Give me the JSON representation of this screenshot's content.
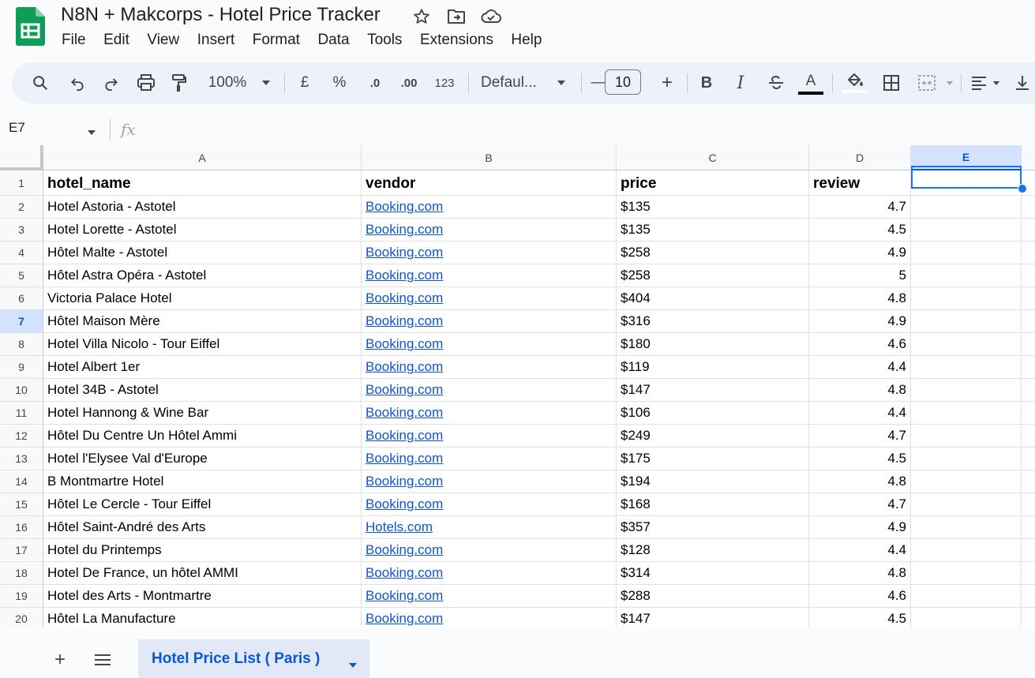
{
  "app": {
    "title": "N8N + Makcorps - Hotel Price Tracker",
    "menu": [
      "File",
      "Edit",
      "View",
      "Insert",
      "Format",
      "Data",
      "Tools",
      "Extensions",
      "Help"
    ],
    "title_icons": [
      "star-icon",
      "move-folder-icon",
      "cloud-status-icon"
    ]
  },
  "toolbar": {
    "zoom": "100%",
    "currency": "£",
    "percent": "%",
    "decrease_decimal": ".0",
    "increase_decimal": ".00",
    "number_format": "123",
    "font": "Defaul...",
    "font_size": "10",
    "minus": "—",
    "plus": "+",
    "bold": "B",
    "italic": "I",
    "text_color_letter": "A",
    "icons": [
      "search-icon",
      "undo-icon",
      "redo-icon",
      "print-icon",
      "paint-format-icon",
      "strikethrough-icon",
      "fill-color-icon",
      "borders-icon",
      "merge-cells-icon",
      "align-left-icon",
      "vertical-align-icon"
    ]
  },
  "formula_bar": {
    "name_box": "E7",
    "fx": "fx",
    "content": ""
  },
  "grid": {
    "columns": [
      "A",
      "B",
      "C",
      "D",
      "E"
    ],
    "selected_column": "E",
    "selected_row": "7",
    "selected_cell": "E7",
    "header": [
      "hotel_name",
      "vendor",
      "price",
      "review"
    ],
    "rows": [
      [
        "2",
        "Hotel Astoria - Astotel",
        "Booking.com",
        "$135",
        "4.7"
      ],
      [
        "3",
        "Hotel Lorette - Astotel",
        "Booking.com",
        "$135",
        "4.5"
      ],
      [
        "4",
        "Hôtel Malte - Astotel",
        "Booking.com",
        "$258",
        "4.9"
      ],
      [
        "5",
        "Hôtel Astra Opéra - Astotel",
        "Booking.com",
        "$258",
        "5"
      ],
      [
        "6",
        "Victoria Palace Hotel",
        "Booking.com",
        "$404",
        "4.8"
      ],
      [
        "7",
        "Hôtel Maison Mère",
        "Booking.com",
        "$316",
        "4.9"
      ],
      [
        "8",
        "Hotel Villa Nicolo - Tour Eiffel",
        "Booking.com",
        "$180",
        "4.6"
      ],
      [
        "9",
        "Hotel Albert 1er",
        "Booking.com",
        "$119",
        "4.4"
      ],
      [
        "10",
        "Hotel 34B - Astotel",
        "Booking.com",
        "$147",
        "4.8"
      ],
      [
        "11",
        "Hotel Hannong & Wine Bar",
        "Booking.com",
        "$106",
        "4.4"
      ],
      [
        "12",
        "Hôtel Du Centre Un Hôtel Ammi",
        "Booking.com",
        "$249",
        "4.7"
      ],
      [
        "13",
        "Hotel l'Elysee Val d'Europe",
        "Booking.com",
        "$175",
        "4.5"
      ],
      [
        "14",
        "B Montmartre Hotel",
        "Booking.com",
        "$194",
        "4.8"
      ],
      [
        "15",
        "Hôtel Le Cercle - Tour Eiffel",
        "Booking.com",
        "$168",
        "4.7"
      ],
      [
        "16",
        "Hôtel Saint-André des Arts",
        "Hotels.com",
        "$357",
        "4.9"
      ],
      [
        "17",
        "Hotel du Printemps",
        "Booking.com",
        "$128",
        "4.4"
      ],
      [
        "18",
        "Hotel De France, un hôtel AMMI",
        "Booking.com",
        "$314",
        "4.8"
      ],
      [
        "19",
        "Hotel des Arts - Montmartre",
        "Booking.com",
        "$288",
        "4.6"
      ],
      [
        "20",
        "Hôtel La Manufacture",
        "Booking.com",
        "$147",
        "4.5"
      ]
    ]
  },
  "sheets": {
    "add": "+",
    "active_tab": "Hotel Price List ( Paris )"
  },
  "colors": {
    "accent": "#0b57d0",
    "link": "#1155cc",
    "sheets_green": "#0f9d58",
    "selection": "#1a73e8"
  }
}
